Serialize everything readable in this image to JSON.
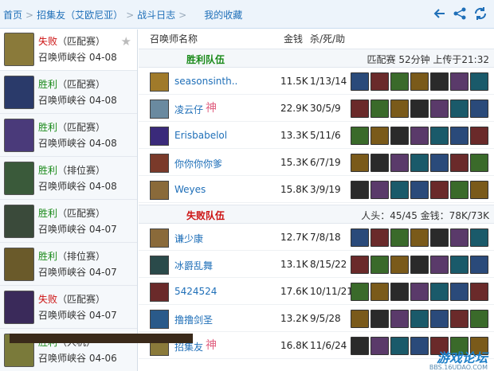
{
  "breadcrumbs": [
    "首页",
    "招集友（艾欧尼亚）",
    "战斗日志",
    "我的收藏"
  ],
  "icons": [
    "back-arrow-icon",
    "share-icon",
    "refresh-icon"
  ],
  "matches": [
    {
      "result": "失败",
      "type": "（匹配赛）",
      "map": "召唤师峡谷",
      "date": "04-08",
      "win": false,
      "selected": true,
      "color": "#8a7a3a"
    },
    {
      "result": "胜利",
      "type": "（匹配赛）",
      "map": "召唤师峡谷",
      "date": "04-08",
      "win": true,
      "color": "#2a3a6a"
    },
    {
      "result": "胜利",
      "type": "（匹配赛）",
      "map": "召唤师峡谷",
      "date": "04-08",
      "win": true,
      "color": "#4a3a7a"
    },
    {
      "result": "胜利",
      "type": "（排位赛）",
      "map": "召唤师峡谷",
      "date": "04-08",
      "win": true,
      "color": "#3a5a3a"
    },
    {
      "result": "胜利",
      "type": "（匹配赛）",
      "map": "召唤师峡谷",
      "date": "04-07",
      "win": true,
      "color": "#3a4a3a"
    },
    {
      "result": "胜利",
      "type": "（排位赛）",
      "map": "召唤师峡谷",
      "date": "04-07",
      "win": true,
      "color": "#6a5a2a"
    },
    {
      "result": "失败",
      "type": "（匹配赛）",
      "map": "召唤师峡谷",
      "date": "04-07",
      "win": false,
      "color": "#3a2a5a"
    },
    {
      "result": "胜利",
      "type": "（人机）",
      "map": "召唤师峡谷",
      "date": "04-06",
      "win": true,
      "color": "#7a7a3a"
    }
  ],
  "columns": {
    "name": "召唤师名称",
    "gold": "金钱",
    "kda": "杀/死/助"
  },
  "winTeam": {
    "label": "胜利队伍",
    "info": "匹配赛 52分钟 上传于21:32",
    "players": [
      {
        "name": "seasonsinth..",
        "gold": "11.5K",
        "kda": "1/13/14",
        "tags": [],
        "color": "#a07a2a"
      },
      {
        "name": "凌云仔",
        "gold": "22.9K",
        "kda": "30/5/9",
        "tags": [
          "神"
        ],
        "color": "#6a8aa0"
      },
      {
        "name": "Erisbabelol",
        "gold": "13.3K",
        "kda": "5/11/6",
        "tags": [],
        "color": "#3a2a7a"
      },
      {
        "name": "你你你你爹",
        "gold": "15.3K",
        "kda": "6/7/19",
        "tags": [],
        "color": "#7a3a2a"
      },
      {
        "name": "Weyes",
        "gold": "15.8K",
        "kda": "3/9/19",
        "tags": [],
        "color": "#8a6a3a"
      }
    ]
  },
  "lossTeam": {
    "label": "失败队伍",
    "info": "人头：45/45 金钱：78K/73K",
    "players": [
      {
        "name": "谦少康",
        "gold": "12.7K",
        "kda": "7/8/18",
        "tags": [],
        "color": "#8a6a3a"
      },
      {
        "name": "冰爵乱舞",
        "gold": "13.1K",
        "kda": "8/15/22",
        "tags": [],
        "color": "#2a4a4a"
      },
      {
        "name": "5424524",
        "gold": "17.6K",
        "kda": "10/11/21",
        "tags": [],
        "color": "#6a2a2a"
      },
      {
        "name": "撸撸剑圣",
        "gold": "13.2K",
        "kda": "9/5/28",
        "tags": [],
        "color": "#2a5a8a"
      },
      {
        "name": "招集友",
        "gold": "16.8K",
        "kda": "11/6/24",
        "tags": [
          "神"
        ],
        "color": "#8a7a3a"
      }
    ]
  },
  "watermark": "游戏论坛",
  "watermark_sub": "BBS.16UDAO.COM"
}
